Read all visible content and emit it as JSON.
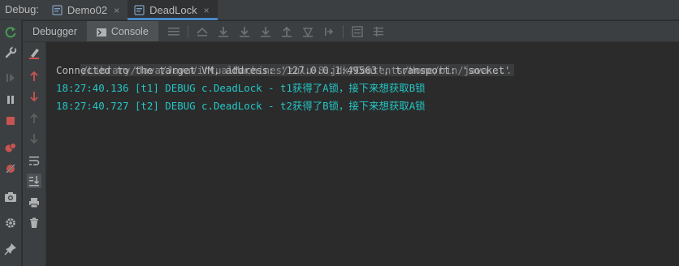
{
  "topbar": {
    "label": "Debug:",
    "tabs": [
      {
        "label": "Demo02",
        "close": "×"
      },
      {
        "label": "DeadLock",
        "close": "×"
      }
    ]
  },
  "subbar": {
    "debugger_label": "Debugger",
    "console_label": "Console"
  },
  "console": {
    "command": "/Library/Java/JavaVirtualMachines/zulu-8.jdk/Contents/Home/bin/java ...",
    "connected": "Connected to the target VM, address: '127.0.0.1:49563', transport: 'socket'",
    "logs": [
      "18:27:40.136 [t1] DEBUG c.DeadLock - t1获得了A锁，接下来想获取B锁",
      "18:27:40.727 [t2] DEBUG c.DeadLock - t2获得了B锁，接下来想获取A锁"
    ]
  },
  "colors": {
    "accent": "#4a88c7",
    "log_text": "#25c6c6",
    "resume_green": "#499c54",
    "stop_red": "#c75450"
  }
}
